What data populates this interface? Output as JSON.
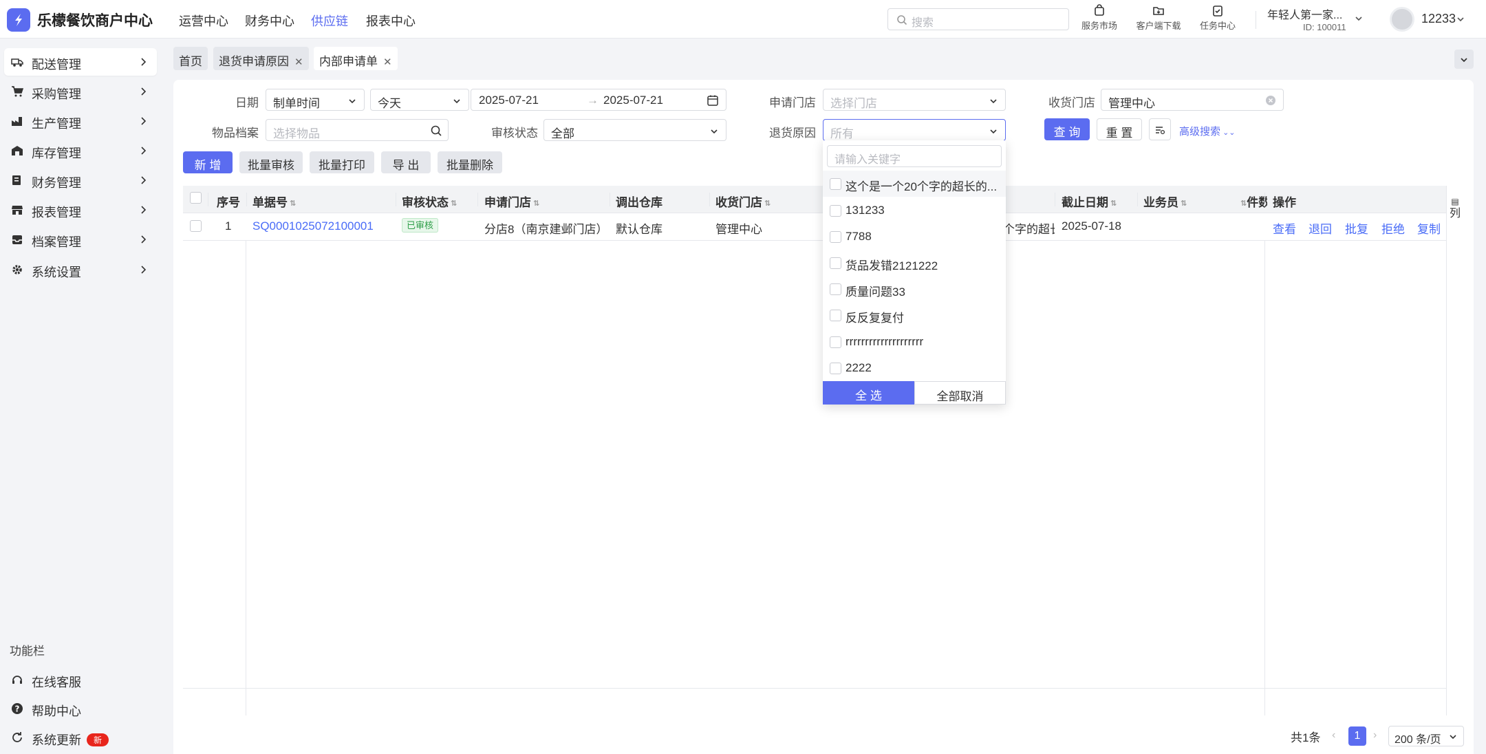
{
  "app": {
    "brand": "乐檬餐饮商户中心"
  },
  "topnav": [
    "运营中心",
    "财务中心",
    "供应链",
    "报表中心"
  ],
  "search": {
    "placeholder": "搜索"
  },
  "tools": [
    "服务市场",
    "客户端下载",
    "任务中心"
  ],
  "account": {
    "name": "年轻人第一家...",
    "id": "ID: 100011",
    "user": "12233"
  },
  "sidebar": {
    "items": [
      "配送管理",
      "采购管理",
      "生产管理",
      "库存管理",
      "财务管理",
      "报表管理",
      "档案管理",
      "系统设置"
    ],
    "func_title": "功能栏",
    "func_items": [
      "在线客服",
      "帮助中心",
      "系统更新"
    ],
    "new_badge": "新"
  },
  "tabs": [
    "首页",
    "退货申请原因",
    "内部申请单"
  ],
  "filters": {
    "date_label": "日期",
    "date_type": "制单时间",
    "date_range": "今天",
    "date_start": "2025-07-21",
    "date_end": "2025-07-21",
    "apply_store_label": "申请门店",
    "apply_store_placeholder": "选择门店",
    "receive_store_label": "收货门店",
    "receive_store_value": "管理中心",
    "item_label": "物品档案",
    "item_placeholder": "选择物品",
    "audit_label": "审核状态",
    "audit_value": "全部",
    "reason_label": "退货原因",
    "reason_placeholder": "所有",
    "query": "查 询",
    "reset": "重 置",
    "advanced": "高级搜索"
  },
  "actions": [
    "新 增",
    "批量审核",
    "批量打印",
    "导 出",
    "批量删除"
  ],
  "table": {
    "headers": [
      "序号",
      "单据号",
      "审核状态",
      "申请门店",
      "调出仓库",
      "收货门店",
      "截止日期",
      "业务员",
      "件数",
      "操作"
    ],
    "col_setting": "列",
    "row": {
      "index": "1",
      "doc_no": "SQ0001025072100001",
      "status": "已审核",
      "apply_store": "分店8（南京建邺门店）",
      "warehouse": "默认仓库",
      "receive_store": "管理中心",
      "reason_partial": "个字的超长",
      "deadline": "2025-07-18",
      "ops": [
        "查看",
        "退回",
        "批复",
        "拒绝",
        "复制"
      ]
    }
  },
  "pagination": {
    "total": "共1条",
    "current": "1",
    "page_size": "200 条/页"
  },
  "dropdown": {
    "search_placeholder": "请输入关键字",
    "options": [
      "这个是一个20个字的超长的...",
      "131233",
      "7788",
      "货品发错2121222",
      "质量问题33",
      "反反复复付",
      "rrrrrrrrrrrrrrrrrrrr",
      "2222"
    ],
    "select_all": "全 选",
    "deselect_all": "全部取消"
  },
  "colors": {
    "accent": "#5b6cf0",
    "link": "#4a6cf7",
    "success": "#2e9e48",
    "danger": "#e8251c"
  }
}
